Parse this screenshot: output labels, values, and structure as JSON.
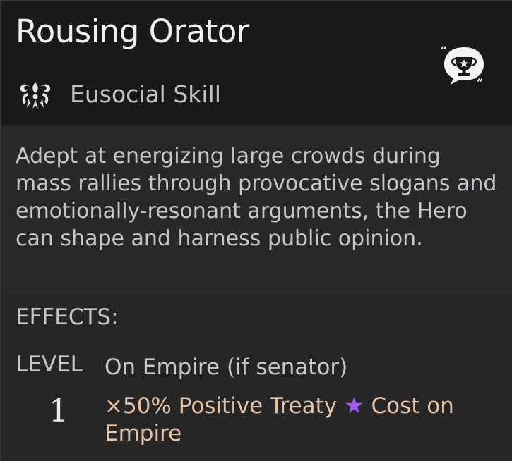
{
  "tooltip": {
    "title": "Rousing Orator",
    "category": {
      "icon": "eusocial-icon",
      "label": "Eusocial Skill"
    },
    "badge_icon": "trophy-speech-icon",
    "description": "Adept at energizing large crowds during mass rallies through provocative slogans and emotionally-resonant arguments, the Hero can shape and harness public opinion.",
    "effects": {
      "heading": "EFFECTS:",
      "level_label": "LEVEL",
      "scope": "On Empire (if senator)",
      "rows": [
        {
          "level": "1",
          "text_before": "×50% Positive Treaty",
          "icon": "influence-star-icon",
          "text_after": "Cost on Empire"
        }
      ]
    }
  },
  "colors": {
    "effect_text": "#e6c2a8",
    "influence_star": "#9c5cf0",
    "title": "#efefef",
    "body_text": "#c4c7cc"
  }
}
